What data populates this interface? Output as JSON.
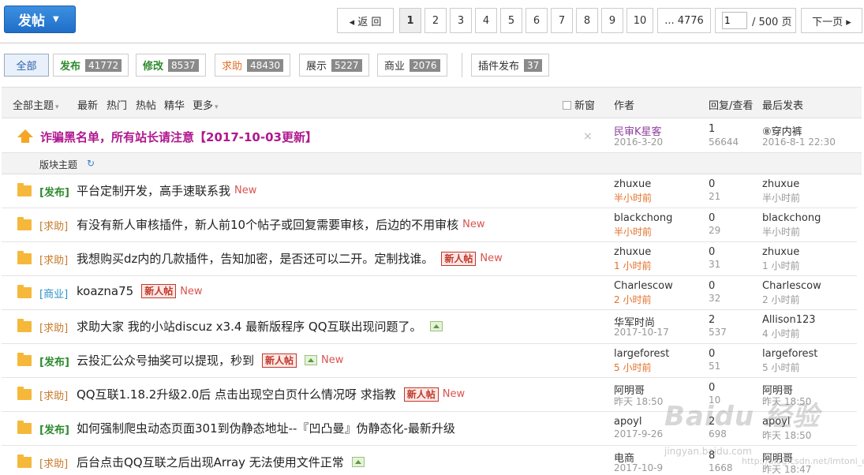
{
  "toolbar": {
    "post_label": "发帖",
    "post_caret": "▼"
  },
  "pagination": {
    "back_label": "◂ 返 回",
    "pages": [
      "1",
      "2",
      "3",
      "4",
      "5",
      "6",
      "7",
      "8",
      "9",
      "10"
    ],
    "last_label": "... 4776",
    "current_value": "1",
    "total_label": "/ 500 页",
    "next_label": "下一页 ▸"
  },
  "types": {
    "all": "全部",
    "items": [
      {
        "label": "发布",
        "count": "41772"
      },
      {
        "label": "修改",
        "count": "8537"
      },
      {
        "label": "求助",
        "count": "48430"
      },
      {
        "label": "展示",
        "count": "5227"
      },
      {
        "label": "商业",
        "count": "2076"
      }
    ],
    "plugin": {
      "label": "插件发布",
      "count": "37"
    }
  },
  "header": {
    "all_topics": "全部主题",
    "caret": "▾",
    "latest": "最新",
    "hot": "热门",
    "hot_posts": "热帖",
    "digest": "精华",
    "more": "更多",
    "new_window": "新窗",
    "author": "作者",
    "reply_view": "回复/查看",
    "last_post": "最后发表"
  },
  "sticky": {
    "title": "诈骗黑名单，所有站长请注意【2017-10-03更新】",
    "close": "×",
    "author": "民审K星客",
    "date": "2016-3-20",
    "replies": "1",
    "views": "56644",
    "last_by": "⑧穿内裤",
    "last_time": "2016-8-1 22:30"
  },
  "section": {
    "label": "版块主题",
    "refresh": "↻"
  },
  "threads": [
    {
      "cat": "[发布]",
      "title": "平台定制开发，高手速联系我",
      "newbie": "",
      "img": false,
      "new": "New",
      "author": "zhuxue",
      "ctime": "半小时前",
      "replies": "0",
      "views": "21",
      "last_by": "zhuxue",
      "last_time": "半小时前"
    },
    {
      "cat": "[求助]",
      "title": "有没有新人审核插件，新人前10个帖子或回复需要审核，后边的不用审核",
      "newbie": "",
      "img": false,
      "new": "New",
      "author": "blackchong",
      "ctime": "半小时前",
      "replies": "0",
      "views": "29",
      "last_by": "blackchong",
      "last_time": "半小时前"
    },
    {
      "cat": "[求助]",
      "title": "我想购买dz内的几款插件，告知加密，是否还可以二开。定制找谁。",
      "newbie": "新人帖",
      "img": false,
      "new": "New",
      "author": "zhuxue",
      "ctime": "1 小时前",
      "replies": "0",
      "views": "31",
      "last_by": "zhuxue",
      "last_time": "1 小时前"
    },
    {
      "cat": "[商业]",
      "title": "koazna75",
      "newbie": "新人帖",
      "img": false,
      "new": "New",
      "author": "Charlescow",
      "ctime": "2 小时前",
      "replies": "0",
      "views": "32",
      "last_by": "Charlescow",
      "last_time": "2 小时前"
    },
    {
      "cat": "[求助]",
      "title": "求助大家 我的小站discuz x3.4 最新版程序 QQ互联出现问题了。",
      "newbie": "",
      "img": true,
      "new": "",
      "author": "华军时尚",
      "ctime": "2017-10-17",
      "replies": "2",
      "views": "537",
      "last_by": "Allison123",
      "last_time": "4 小时前"
    },
    {
      "cat": "[发布]",
      "title": "云投汇公众号抽奖可以提现，秒到",
      "newbie": "新人帖",
      "img": true,
      "new": "New",
      "author": "largeforest",
      "ctime": "5 小时前",
      "replies": "0",
      "views": "51",
      "last_by": "largeforest",
      "last_time": "5 小时前"
    },
    {
      "cat": "[求助]",
      "title": "QQ互联1.18.2升级2.0后 点击出现空白页什么情况呀 求指教",
      "newbie": "新人帖",
      "img": false,
      "new": "New",
      "author": "阿明哥",
      "ctime": "昨天 18:50",
      "replies": "0",
      "views": "10",
      "last_by": "阿明哥",
      "last_time": "昨天 18:50"
    },
    {
      "cat": "[发布]",
      "title": "如何强制爬虫动态页面301到伪静态地址--『凹凸曼』伪静态化-最新升级",
      "newbie": "",
      "img": false,
      "new": "",
      "author": "apoyl",
      "ctime": "2017-9-26",
      "replies": "2",
      "views": "698",
      "last_by": "apoyl",
      "last_time": "昨天 18:50"
    },
    {
      "cat": "[求助]",
      "title": "后台点击QQ互联之后出现Array 无法使用文件正常",
      "newbie": "",
      "img": true,
      "new": "",
      "author": "电商",
      "ctime": "2017-10-9",
      "replies": "8",
      "views": "1668",
      "last_by": "阿明哥",
      "last_time": "昨天 18:47"
    }
  ],
  "watermark": {
    "logo": "Baidu 经验",
    "sub": "jingyan.baidu.com",
    "url": "http://blog.csdn.net/lmtoni_cy"
  }
}
